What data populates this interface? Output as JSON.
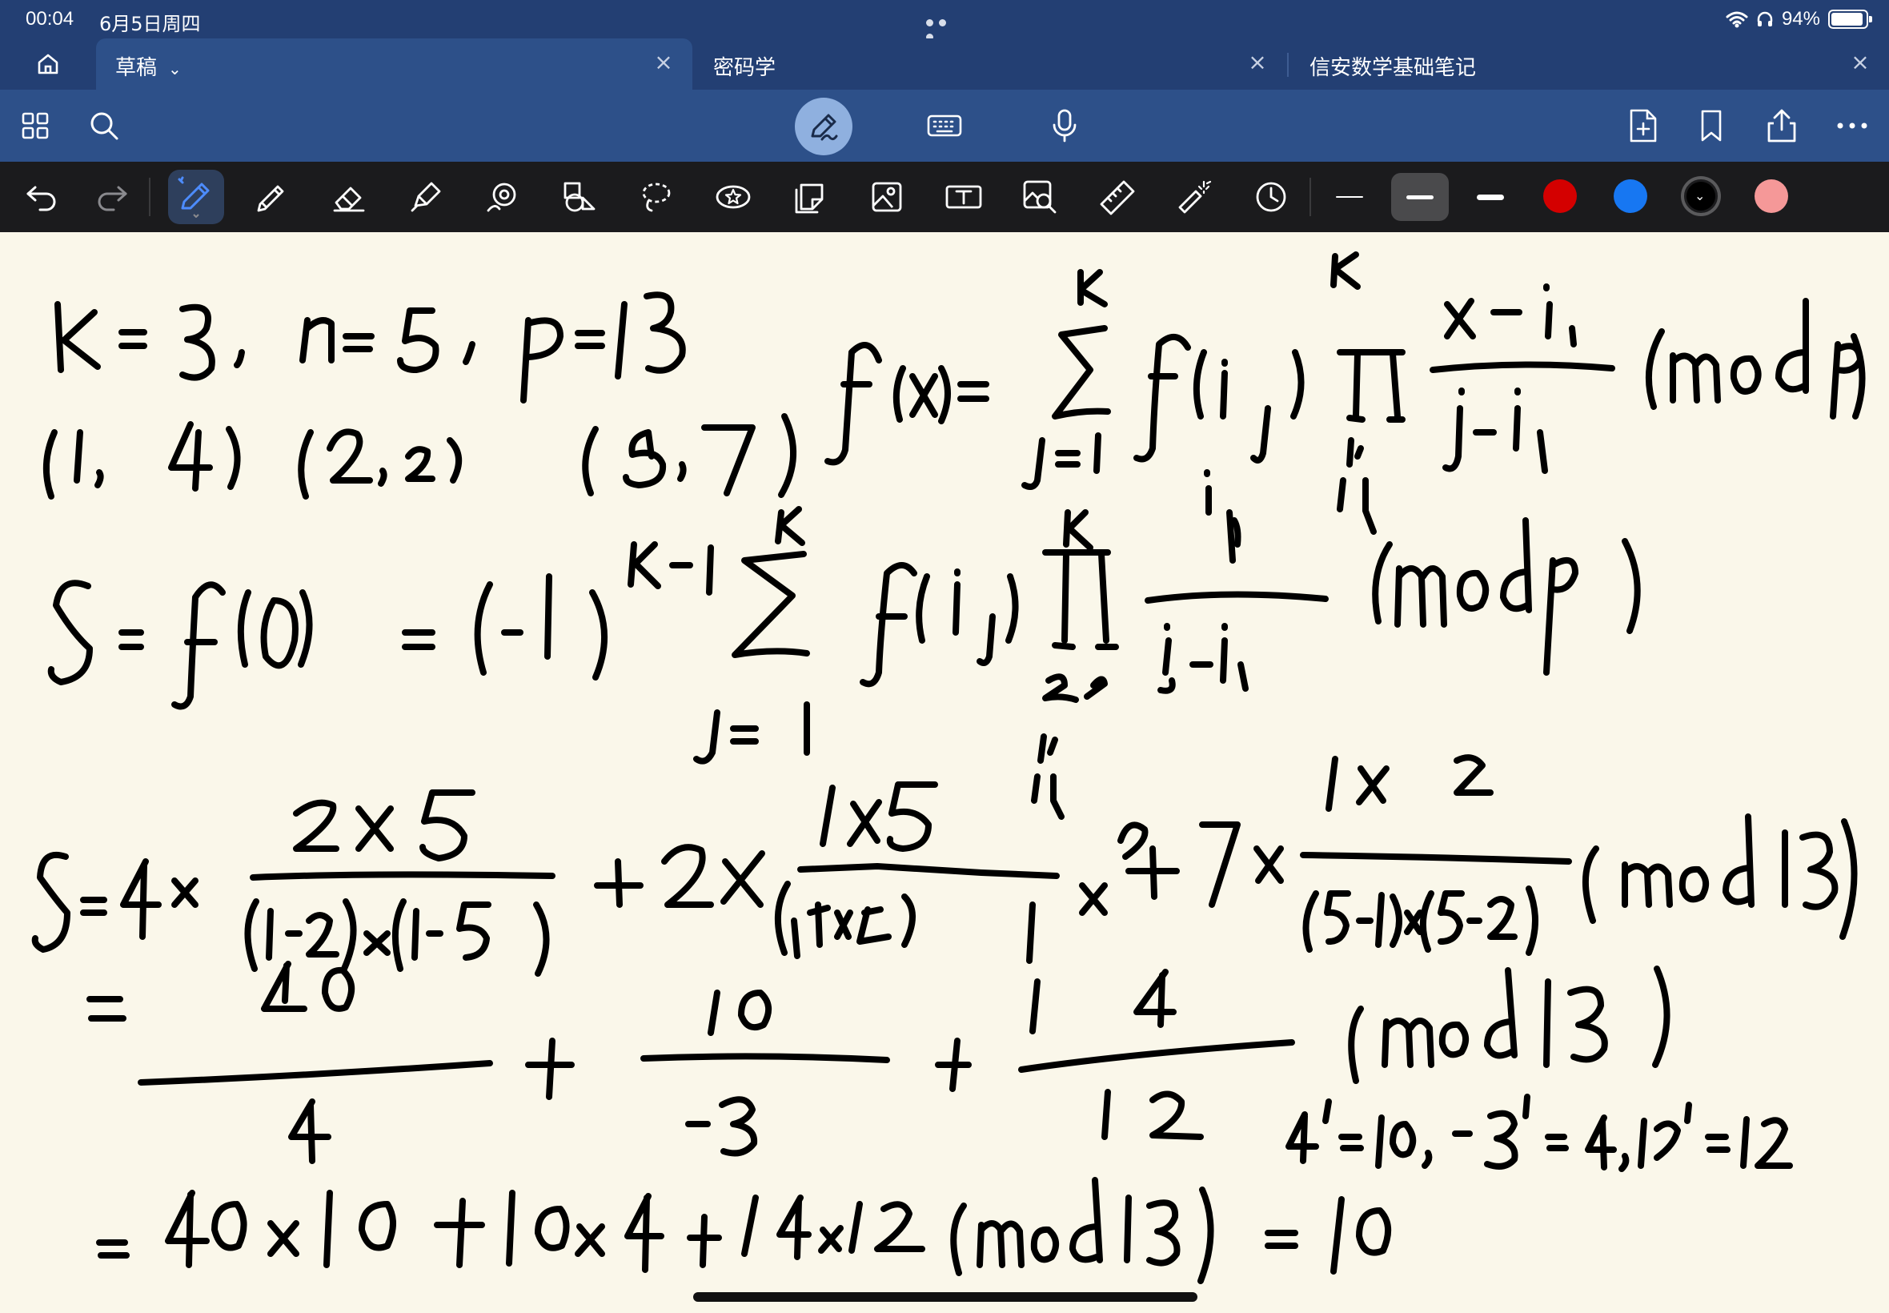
{
  "status": {
    "time": "00:04",
    "date": "6月5日周四",
    "battery": "94%",
    "battery_level": 0.94
  },
  "tabs": [
    {
      "label": "草稿",
      "active": true
    },
    {
      "label": "密码学",
      "active": false
    },
    {
      "label": "信安数学基础笔记",
      "active": false
    }
  ],
  "toolbar": {
    "left_icons": [
      "grid-icon",
      "search-icon"
    ],
    "center_icons": [
      "pen-mode-icon",
      "keyboard-icon",
      "microphone-icon"
    ],
    "right_icons": [
      "add-page-icon",
      "bookmark-icon",
      "share-icon",
      "more-icon"
    ]
  },
  "tools": {
    "icons": [
      "undo-icon",
      "redo-icon",
      "pen-icon",
      "pencil-icon",
      "eraser-icon",
      "highlighter-icon",
      "shape-recognition-icon",
      "shapes-icon",
      "lasso-icon",
      "sticker-icon",
      "sticky-note-icon",
      "image-icon",
      "text-box-icon",
      "image-search-icon",
      "ruler-icon",
      "laser-pointer-icon",
      "history-icon"
    ],
    "selected_tool": "pen-icon",
    "stroke_widths": [
      "thin",
      "medium",
      "thick"
    ],
    "selected_stroke": "medium",
    "colors": [
      "#d40000",
      "#1777f2",
      "#000000",
      "#f59898"
    ],
    "selected_color": "#000000"
  },
  "colors": {
    "status_bg": "#233f73",
    "toolbar_bg": "#2d5089",
    "toolsbar_bg": "#1b1b1d",
    "canvas_bg": "#faf7ea",
    "ink": "#000000"
  },
  "handwriting": {
    "line1": "K=3, n=5, p=13",
    "line2": "(1,4) (2,2) (5,7)",
    "formula1": "f(x)=Σ_{j=1}^{K} f(i_j) ∏_{l=1, l≠j}^{K} (x-i_l)/(i_j-i_l) (mod p)",
    "formula2": "S=f(0)=(-1)^{K-1} Σ_{j=1}^{K} f(i_j) ∏_{l=1, l≠j}^{K} i_l/(i_j-i_l) (mod p)",
    "line3": "S=4×(2×5)/((1-2)×(1-5)) + 2×(1×5)/((2-1)×(2-5)) + 7×(1×2)/((5-1)×(5-2)) (mod 13)",
    "line4": "= 40/4 + 10/-3 + 14/12 (mod 13)",
    "inverses": "4^-1=10, -3^-1=4, 12^-1=12",
    "line5": "= 40×10 + 10×4 + 14×12 (mod 13) = 10"
  }
}
